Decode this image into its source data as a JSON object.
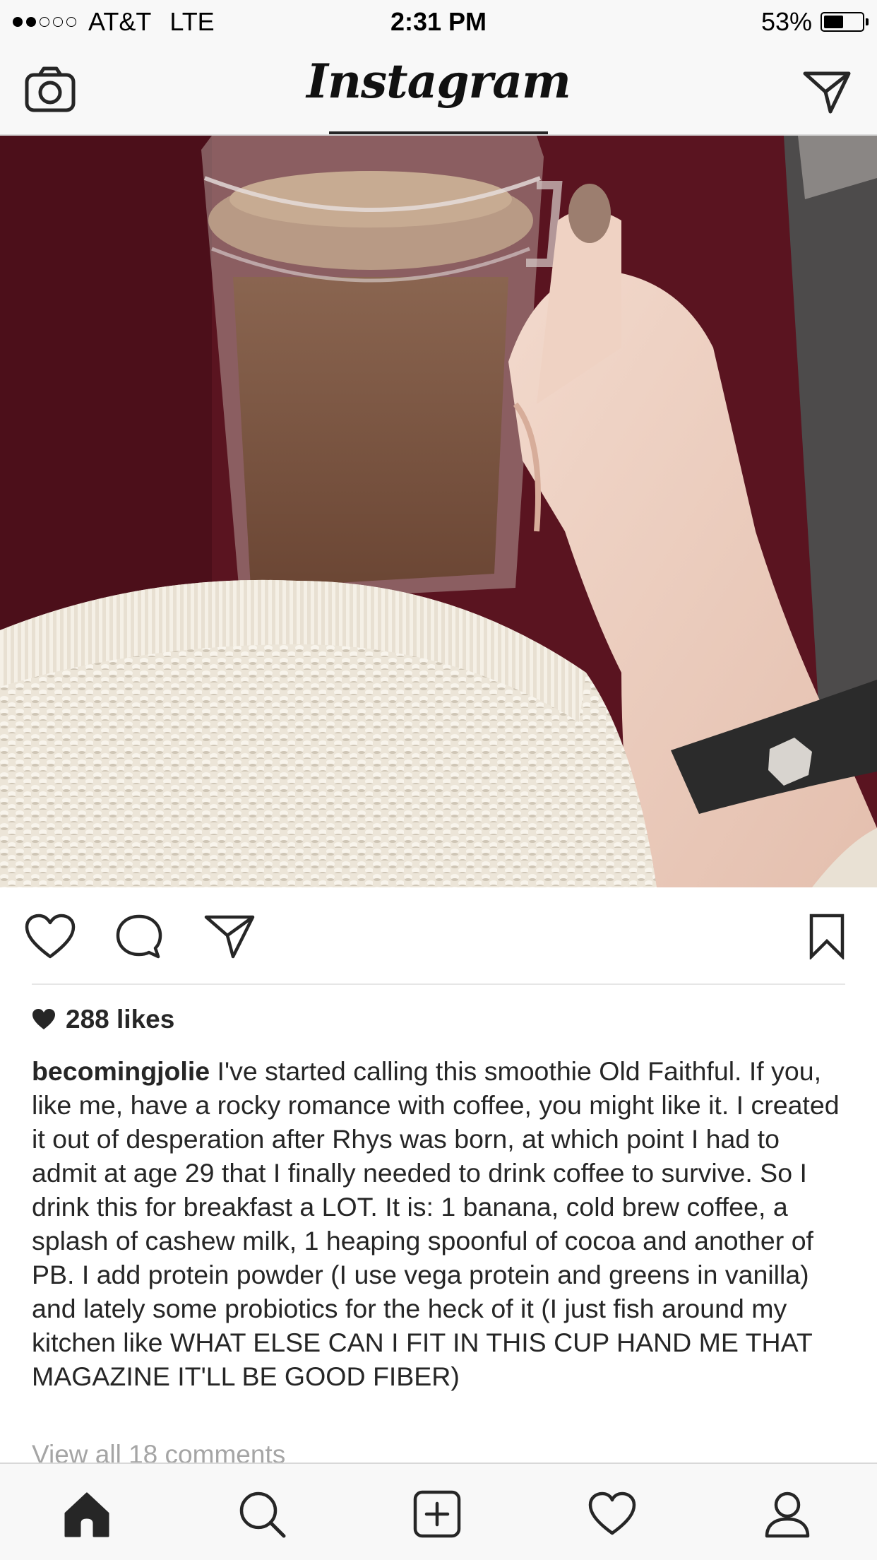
{
  "status_bar": {
    "carrier": "AT&T",
    "network": "LTE",
    "time": "2:31 PM",
    "battery_percent": "53%",
    "battery_level": 0.53,
    "signal_strength": 2,
    "signal_max": 5
  },
  "nav": {
    "title": "Instagram",
    "left_icon": "camera-icon",
    "right_icon": "direct-message-icon"
  },
  "post": {
    "photo_description_icon": "photo",
    "actions": [
      "heart-icon",
      "comment-icon",
      "share-icon",
      "bookmark-icon"
    ],
    "likes": "288 likes",
    "caption_user": "becomingjolie",
    "caption_text": " I've started calling this smoothie Old Faithful. If you, like me, have a rocky romance with coffee, you might like it. I created it out of desperation after Rhys was born, at which point I had to admit at age 29 that I finally needed to drink coffee to survive. So I drink this for breakfast a LOT. It is: 1 banana, cold brew coffee, a splash of cashew milk, 1 heaping spoonful of cocoa and another of PB. I add protein powder (I use vega protein and greens in vanilla) and lately some probiotics for the heck of it (I just fish around my kitchen like WHAT ELSE CAN I FIT IN THIS CUP HAND ME THAT MAGAZINE IT'LL BE GOOD FIBER)",
    "view_comments": "View all 18 comments"
  },
  "tab_bar": {
    "tabs": [
      "home-icon",
      "search-icon",
      "add-post-icon",
      "activity-icon",
      "profile-icon"
    ],
    "active": "home-icon"
  },
  "colors": {
    "bar_background": "#f8f8f8",
    "text": "#262626",
    "muted": "#a5a5a5",
    "divider": "#e6e6e6"
  }
}
